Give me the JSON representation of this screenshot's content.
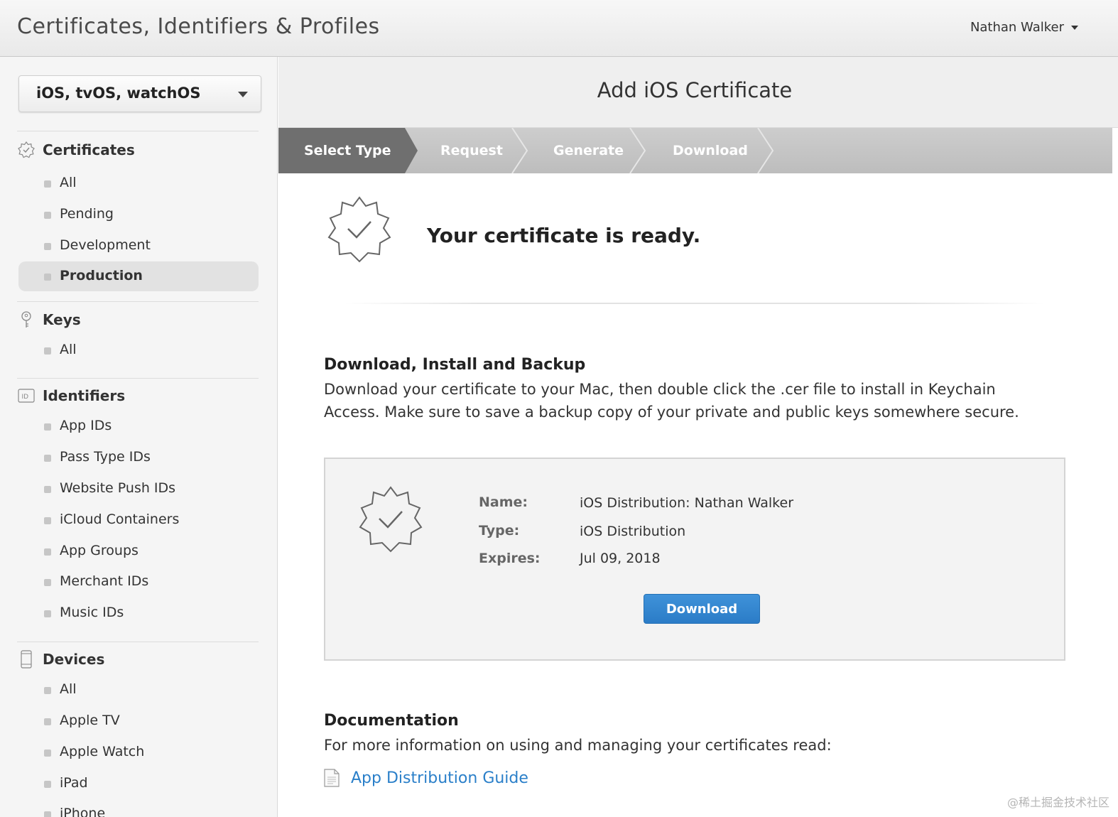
{
  "header": {
    "app_title": "Certificates, Identifiers & Profiles",
    "user_name": "Nathan Walker"
  },
  "sidebar": {
    "platform_selector": "iOS, tvOS, watchOS",
    "sections": [
      {
        "title": "Certificates",
        "icon": "certificate-badge-icon",
        "items": [
          "All",
          "Pending",
          "Development",
          "Production"
        ],
        "active": "Production"
      },
      {
        "title": "Keys",
        "icon": "key-icon",
        "items": [
          "All"
        ]
      },
      {
        "title": "Identifiers",
        "icon": "id-card-icon",
        "items": [
          "App IDs",
          "Pass Type IDs",
          "Website Push IDs",
          "iCloud Containers",
          "App Groups",
          "Merchant IDs",
          "Music IDs"
        ]
      },
      {
        "title": "Devices",
        "icon": "phone-device-icon",
        "items": [
          "All",
          "Apple TV",
          "Apple Watch",
          "iPad",
          "iPhone"
        ]
      }
    ]
  },
  "main": {
    "page_title": "Add iOS Certificate",
    "steps": [
      "Select Type",
      "Request",
      "Generate",
      "Download"
    ],
    "active_step": "Select Type",
    "ready_message": "Your certificate is ready.",
    "install_heading": "Download, Install and Backup",
    "install_text_line1": "Download your certificate to your Mac, then double click the .cer file to install in Keychain",
    "install_text_line2": "Access. Make sure to save a backup copy of your private and public keys somewhere secure.",
    "certificate": {
      "name_label": "Name:",
      "name_value": "iOS Distribution: Nathan Walker",
      "type_label": "Type:",
      "type_value": "iOS Distribution",
      "expires_label": "Expires:",
      "expires_value": "Jul 09, 2018",
      "download_label": "Download"
    },
    "doc_heading": "Documentation",
    "doc_text": "For more information on using and managing your certificates read:",
    "doc_link": "App Distribution Guide"
  },
  "watermark": "@稀土掘金技术社区",
  "colors": {
    "accent_blue": "#2b7cc7",
    "link_blue": "#2a7fc9",
    "active_step": "#6f6f6f"
  }
}
